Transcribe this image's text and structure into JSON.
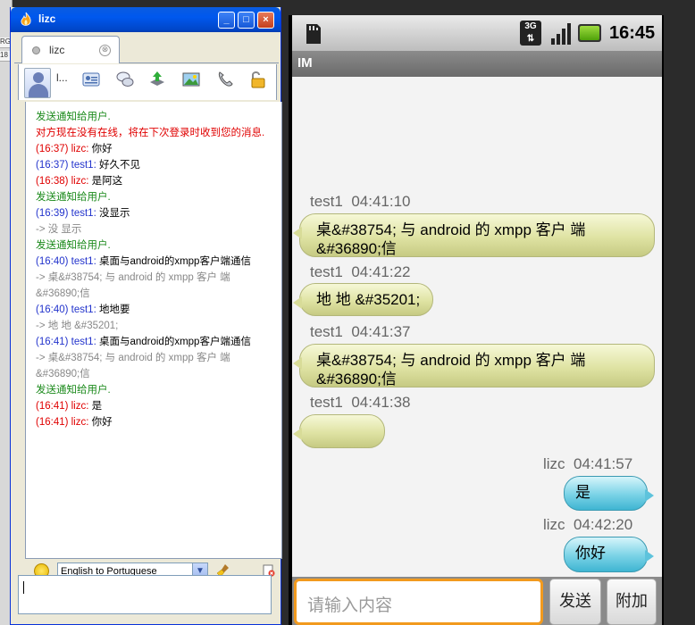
{
  "bg": {
    "tiny_labels": [
      "RG",
      "18"
    ]
  },
  "client": {
    "title": "lizc",
    "tab_label": "lizc",
    "tab_close": "⊗",
    "user_short": "l...",
    "buttons": {
      "min": "_",
      "max": "□",
      "close": "×"
    },
    "messages": [
      [
        {
          "c": "green",
          "t": "发送通知给用户."
        }
      ],
      [
        {
          "c": "red",
          "t": "对方现在没有在线，将在下次登录时收到您的消息."
        }
      ],
      [
        {
          "c": "red",
          "t": "(16:37) lizc: "
        },
        {
          "c": "blk",
          "t": "你好"
        }
      ],
      [
        {
          "c": "blue",
          "t": "(16:37) test1: "
        },
        {
          "c": "blk",
          "t": "好久不见"
        }
      ],
      [
        {
          "c": "red",
          "t": "(16:38) lizc: "
        },
        {
          "c": "blk",
          "t": "是阿这"
        }
      ],
      [
        {
          "c": "green",
          "t": "发送通知给用户."
        }
      ],
      [
        {
          "c": "blue",
          "t": "(16:39) test1: "
        },
        {
          "c": "blk",
          "t": "没显示"
        }
      ],
      [
        {
          "c": "gray",
          "t": "-> 没 显示"
        }
      ],
      [
        {
          "c": "green",
          "t": "发送通知给用户."
        }
      ],
      [
        {
          "c": "blue",
          "t": "(16:40) test1: "
        },
        {
          "c": "blk",
          "t": "桌面与android的xmpp客户端通信"
        }
      ],
      [
        {
          "c": "gray",
          "t": "-> 桌&#38754; 与 android 的 xmpp 客户 端"
        }
      ],
      [
        {
          "c": "gray",
          "t": "&#36890;信"
        }
      ],
      [
        {
          "c": "blue",
          "t": "(16:40) test1: "
        },
        {
          "c": "blk",
          "t": "地地要"
        }
      ],
      [
        {
          "c": "gray",
          "t": "-> 地 地 &#35201;"
        }
      ],
      [
        {
          "c": "blue",
          "t": "(16:41) test1: "
        },
        {
          "c": "blk",
          "t": "桌面与android的xmpp客户端通信"
        }
      ],
      [
        {
          "c": "gray",
          "t": "-> 桌&#38754; 与 android 的 xmpp 客户 端"
        }
      ],
      [
        {
          "c": "gray",
          "t": "&#36890;信"
        }
      ],
      [
        {
          "c": "green",
          "t": "发送通知给用户."
        }
      ],
      [
        {
          "c": "red",
          "t": "(16:41) lizc: "
        },
        {
          "c": "blk",
          "t": "是"
        }
      ],
      [
        {
          "c": "red",
          "t": "(16:41) lizc: "
        },
        {
          "c": "blk",
          "t": "你好"
        }
      ]
    ],
    "language_select": "English to Portuguese",
    "language_dropdown_glyph": "▼"
  },
  "phone": {
    "status": {
      "network": "3G",
      "time": "16:45"
    },
    "app_title": "IM",
    "chat": [
      {
        "side": "left",
        "sender": "test1",
        "time": "04:41:10",
        "lines": [
          "桌&#38754; 与 android 的 xmpp 客户 端",
          "&#36890;信"
        ]
      },
      {
        "side": "left",
        "sender": "test1",
        "time": "04:41:22",
        "lines": [
          "地 地 &#35201;"
        ]
      },
      {
        "side": "left",
        "sender": "test1",
        "time": "04:41:37",
        "lines": [
          "桌&#38754; 与 android 的 xmpp 客户 端",
          "&#36890;信"
        ]
      },
      {
        "side": "left",
        "sender": "test1",
        "time": "04:41:38",
        "lines": [
          ""
        ]
      },
      {
        "side": "right",
        "sender": "lizc",
        "time": "04:41:57",
        "lines": [
          "是"
        ]
      },
      {
        "side": "right",
        "sender": "lizc",
        "time": "04:42:20",
        "lines": [
          "你好"
        ]
      }
    ],
    "input_placeholder": "请输入内容",
    "send_label": "发送",
    "attach_label": "附加"
  },
  "colors": {
    "titlebar": "#0058ee",
    "received_bubble": "#dfe3a3",
    "sent_bubble": "#79d2e6",
    "input_focus": "#f29a1e"
  }
}
